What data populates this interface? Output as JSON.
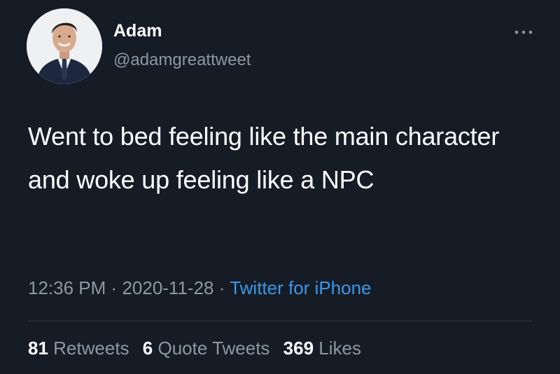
{
  "user": {
    "display_name": "Adam",
    "handle": "@adamgreattweet",
    "avatar_icon": "profile-photo-man-in-suit"
  },
  "menu": {
    "more_icon": "more-horizontal-icon"
  },
  "tweet": {
    "text": "Went to bed feeling like the main character and woke up feeling like a NPC",
    "time": "12:36 PM",
    "separator": "·",
    "date": "2020-11-28",
    "source": "Twitter for iPhone"
  },
  "stats": {
    "retweets_count": "81",
    "retweets_label": "Retweets",
    "quotes_count": "6",
    "quotes_label": "Quote Tweets",
    "likes_count": "369",
    "likes_label": "Likes"
  },
  "colors": {
    "background": "#151c26",
    "text_primary": "#ffffff",
    "text_secondary": "#8b98a5",
    "link": "#3d98e6",
    "divider": "#2f3842"
  }
}
